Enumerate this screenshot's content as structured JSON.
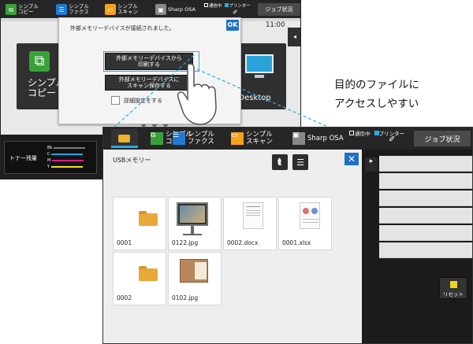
{
  "back_screen": {
    "toolbar": {
      "simple_copy": "シンプル\nコピー",
      "simple_fax": "シンプル\nファクス",
      "simple_scan": "シンプル\nスキャン",
      "sharp_osa": "Sharp OSA",
      "comm_status": "通信中",
      "printer_status": "プリンター",
      "job_status": "ジョブ状況"
    },
    "clock": "11:00",
    "tile_copy_label": "シンプル\nコピー",
    "tile_desktop_label": "P/Desktop",
    "toner": {
      "label": "トナー残量",
      "colors": [
        "Bk",
        "C",
        "M",
        "Y"
      ]
    },
    "dialog": {
      "message": "外部メモリーデバイスが接続されました。",
      "ok_label": "OK",
      "print_button": "外部メモリーデバイスから\n印刷する",
      "scan_save_button": "外部メモリーデバイスに\nスキャン保存する",
      "detail_setting": "詳細設定をする"
    }
  },
  "front_screen": {
    "toolbar": {
      "simple_copy": "シンプル\nコピー",
      "simple_fax": "シンプル\nファクス",
      "simple_scan": "シンプル\nスキャン",
      "sharp_osa": "Sharp OSA",
      "comm_status": "通信中",
      "printer_status": "プリンター",
      "job_status": "ジョブ状況"
    },
    "location": "USBメモリー",
    "close_label": "✕",
    "files": [
      {
        "name": "0001",
        "kind": "folder"
      },
      {
        "name": "0122.jpg",
        "kind": "image-monitor"
      },
      {
        "name": "0002.docx",
        "kind": "doc"
      },
      {
        "name": "0001.xlsx",
        "kind": "sheet"
      },
      {
        "name": "0002",
        "kind": "folder"
      },
      {
        "name": "0102.jpg",
        "kind": "image-book"
      }
    ],
    "reset_label": "リセット"
  },
  "caption": "目的のファイルに\nアクセスしやすい",
  "colors": {
    "toolbar_bg": "#262626",
    "accent_blue": "#1f70c8",
    "green": "#3aa13a",
    "orange": "#f5a21a",
    "highlight": "#22aee8"
  }
}
